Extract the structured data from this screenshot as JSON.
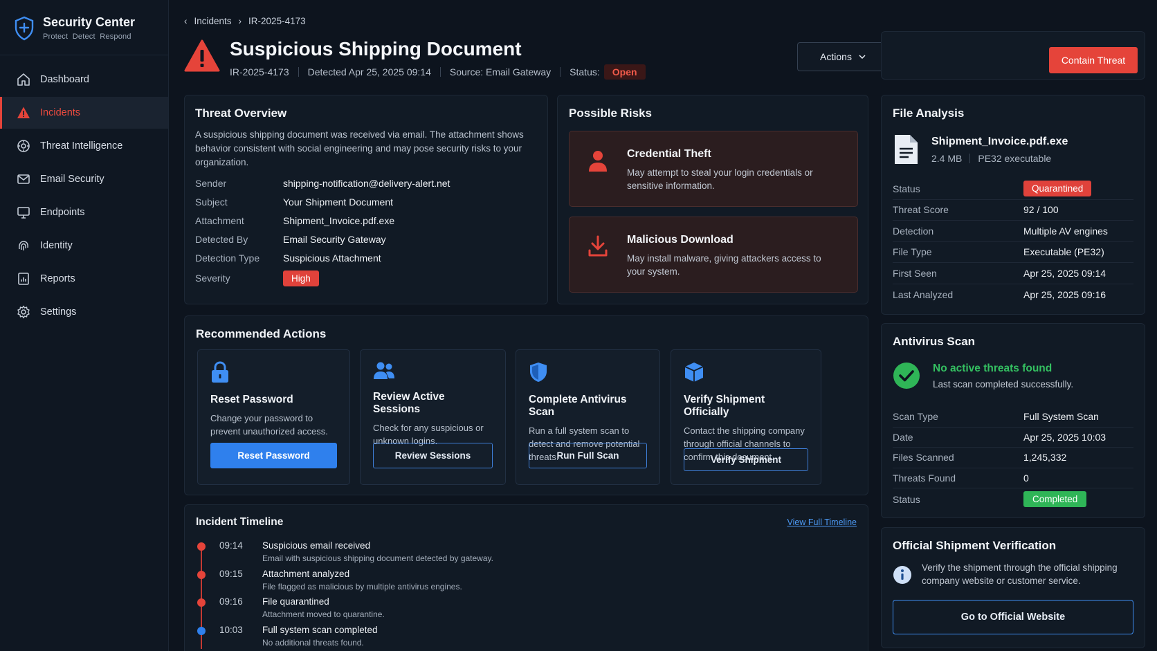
{
  "brand": {
    "title": "Security Center",
    "subtitle": "Protect  Detect  Respond"
  },
  "sidebar": {
    "items": [
      {
        "label": "Dashboard",
        "icon": "home-icon"
      },
      {
        "label": "Incidents",
        "icon": "alert-triangle-icon",
        "active": true
      },
      {
        "label": "Threat Intelligence",
        "icon": "threat-intel-icon"
      },
      {
        "label": "Email Security",
        "icon": "mail-icon"
      },
      {
        "label": "Endpoints",
        "icon": "monitor-icon"
      },
      {
        "label": "Identity",
        "icon": "fingerprint-icon"
      },
      {
        "label": "Reports",
        "icon": "report-icon"
      },
      {
        "label": "Settings",
        "icon": "gear-icon"
      }
    ]
  },
  "breadcrumb": {
    "parent": "Incidents",
    "current": "IR-2025-4173"
  },
  "header": {
    "title": "Suspicious Shipping Document",
    "id": "IR-2025-4173",
    "detected": "Detected Apr 25, 2025 09:14",
    "source": "Source: Email Gateway",
    "status_label": "Status:",
    "status_value": "Open",
    "actions_label": "Actions",
    "contain_label": "Contain Threat"
  },
  "overview": {
    "title": "Threat Overview",
    "description": "A suspicious shipping document was received via email. The attachment shows behavior consistent with social engineering and may pose security risks to your organization.",
    "fields": [
      {
        "key": "Sender",
        "value": "shipping-notification@delivery-alert.net"
      },
      {
        "key": "Subject",
        "value": "Your Shipment Document"
      },
      {
        "key": "Attachment",
        "value": "Shipment_Invoice.pdf.exe"
      },
      {
        "key": "Detected By",
        "value": "Email Security Gateway"
      },
      {
        "key": "Detection Type",
        "value": "Suspicious Attachment"
      }
    ],
    "severity_key": "Severity",
    "severity_value": "High"
  },
  "risks": {
    "title": "Possible Risks",
    "items": [
      {
        "title": "Credential Theft",
        "desc": "May attempt to steal your login credentials or sensitive information."
      },
      {
        "title": "Malicious Download",
        "desc": "May install malware, giving attackers access to your system."
      }
    ]
  },
  "file_analysis": {
    "title": "File Analysis",
    "file_name": "Shipment_Invoice.pdf.exe",
    "file_size": "2.4 MB",
    "file_kind": "PE32 executable",
    "status_key": "Status",
    "status_value": "Quarantined",
    "rows": [
      {
        "key": "Threat Score",
        "value": "92 / 100"
      },
      {
        "key": "Detection",
        "value": "Multiple AV engines"
      },
      {
        "key": "File Type",
        "value": "Executable (PE32)"
      },
      {
        "key": "First Seen",
        "value": "Apr 25, 2025 09:14"
      },
      {
        "key": "Last Analyzed",
        "value": "Apr 25, 2025 09:16"
      }
    ]
  },
  "av_scan": {
    "title": "Antivirus Scan",
    "result": "No active threats found",
    "result_sub": "Last scan completed successfully.",
    "rows": [
      {
        "key": "Scan Type",
        "value": "Full System Scan"
      },
      {
        "key": "Date",
        "value": "Apr 25, 2025 10:03"
      },
      {
        "key": "Files Scanned",
        "value": "1,245,332"
      },
      {
        "key": "Threats Found",
        "value": "0"
      }
    ],
    "status_key": "Status",
    "status_value": "Completed"
  },
  "verification": {
    "title": "Official Shipment Verification",
    "text": "Verify the shipment through the official shipping company website or customer service.",
    "button": "Go to Official Website"
  },
  "recommended": {
    "title": "Recommended Actions",
    "cards": [
      {
        "title": "Reset Password",
        "desc": "Change your password to prevent unauthorized access.",
        "button": "Reset Password"
      },
      {
        "title": "Review Active Sessions",
        "desc": "Check for any suspicious or unknown logins.",
        "button": "Review Sessions"
      },
      {
        "title": "Complete Antivirus Scan",
        "desc": "Run a full system scan to detect and remove potential threats.",
        "button": "Run Full Scan"
      },
      {
        "title": "Verify Shipment Officially",
        "desc": "Contact the shipping company through official channels to confirm this document.",
        "button": "Verify Shipment"
      }
    ]
  },
  "timeline": {
    "title": "Incident Timeline",
    "link": "View Full Timeline",
    "events": [
      {
        "time": "09:14",
        "title": "Suspicious email received",
        "desc": "Email with suspicious shipping document detected by gateway."
      },
      {
        "time": "09:15",
        "title": "Attachment analyzed",
        "desc": "File flagged as malicious by multiple antivirus engines."
      },
      {
        "time": "09:16",
        "title": "File quarantined",
        "desc": "Attachment moved to quarantine."
      },
      {
        "time": "10:03",
        "title": "Full system scan completed",
        "desc": "No additional threats found."
      }
    ]
  },
  "colors": {
    "accent_red": "#e5443a",
    "accent_blue": "#2f80ed",
    "success_green": "#2fb557"
  }
}
